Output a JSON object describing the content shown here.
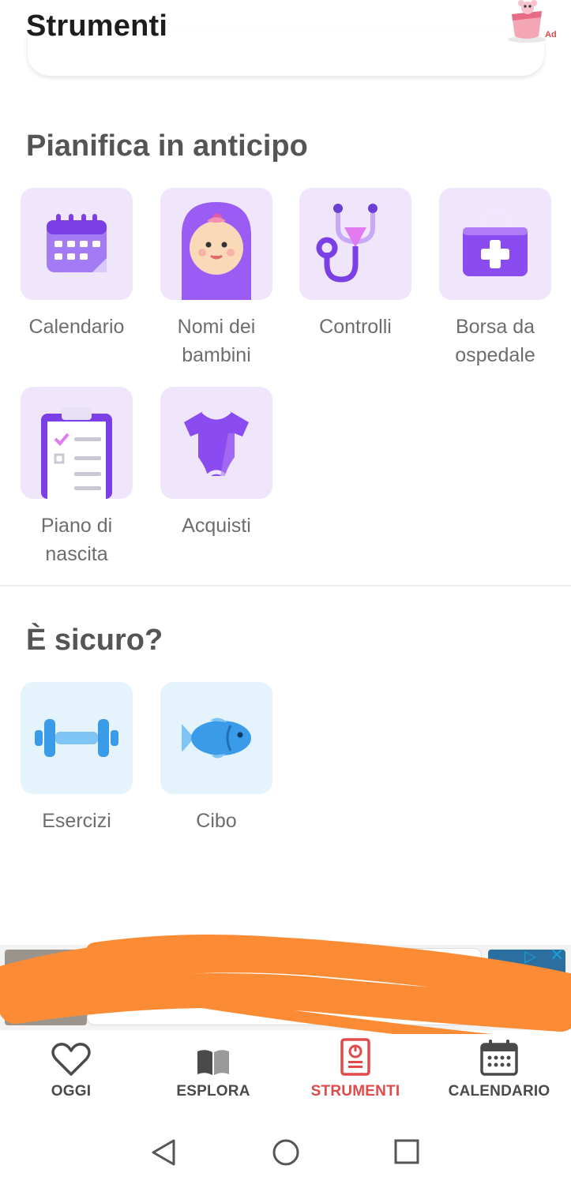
{
  "header": {
    "title": "Strumenti",
    "ad_label": "Ad"
  },
  "sections": [
    {
      "title": "Pianifica in anticipo",
      "tools": [
        {
          "label": "Calendario",
          "icon": "calendar-icon"
        },
        {
          "label": "Nomi dei bambini",
          "icon": "baby-face-icon"
        },
        {
          "label": "Controlli",
          "icon": "stethoscope-icon"
        },
        {
          "label": "Borsa da ospedale",
          "icon": "medical-bag-icon"
        },
        {
          "label": "Piano di nascita",
          "icon": "clipboard-checklist-icon"
        },
        {
          "label": "Acquisti",
          "icon": "baby-bodysuit-icon"
        }
      ]
    },
    {
      "title": "È sicuro?",
      "tools": [
        {
          "label": "Esercizi",
          "icon": "dumbbell-icon"
        },
        {
          "label": "Cibo",
          "icon": "fish-icon"
        }
      ]
    }
  ],
  "tabs": [
    {
      "label": "OGGI",
      "icon": "heart-icon",
      "active": false
    },
    {
      "label": "ESPLORA",
      "icon": "open-book-icon",
      "active": false
    },
    {
      "label": "STRUMENTI",
      "icon": "tools-document-icon",
      "active": true
    },
    {
      "label": "CALENDARIO",
      "icon": "calendar-icon",
      "active": false
    }
  ],
  "colors": {
    "accent_active": "#e14a4a",
    "tile_purple": "#efe6fb",
    "tile_blue": "#e5f3fd",
    "icon_purple": "#8a4cf0",
    "icon_blue": "#3a9be8",
    "redaction": "#fb8c35"
  },
  "system_nav": [
    "back-icon",
    "home-icon",
    "recents-icon"
  ]
}
